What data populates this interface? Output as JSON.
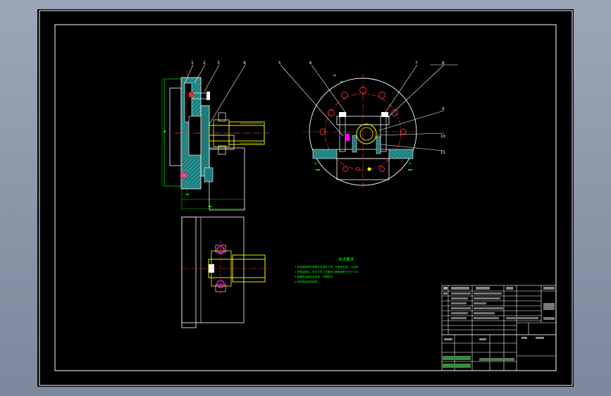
{
  "drawing": {
    "balloon_numbers": [
      "1",
      "2",
      "3",
      "4",
      "5",
      "6",
      "7",
      "8",
      "9",
      "10",
      "11"
    ],
    "section_marks": [
      "A",
      "A"
    ],
    "technical_requirements_title": "技术要求",
    "technical_requirements_lines": [
      "1.夹具装配前所有零件应清洗干净，不得有毛刺、飞边等。",
      "2.夹具装配后，定位元件工作面的平面度误差不大于0.02。",
      "3.各螺纹连接处应拧紧，不得松动。",
      "4.夹具表面涂防锈漆。"
    ]
  },
  "colors": {
    "sheet": "#000000",
    "frame": "#ffffff",
    "leader": "#ffffff",
    "centerline": "#ff3030",
    "dimension": "#00e000",
    "hatch": "#2aa8a8",
    "yellow_part": "#ffff00",
    "magenta_part": "#ff00ff",
    "note_text": "#00ff00"
  }
}
